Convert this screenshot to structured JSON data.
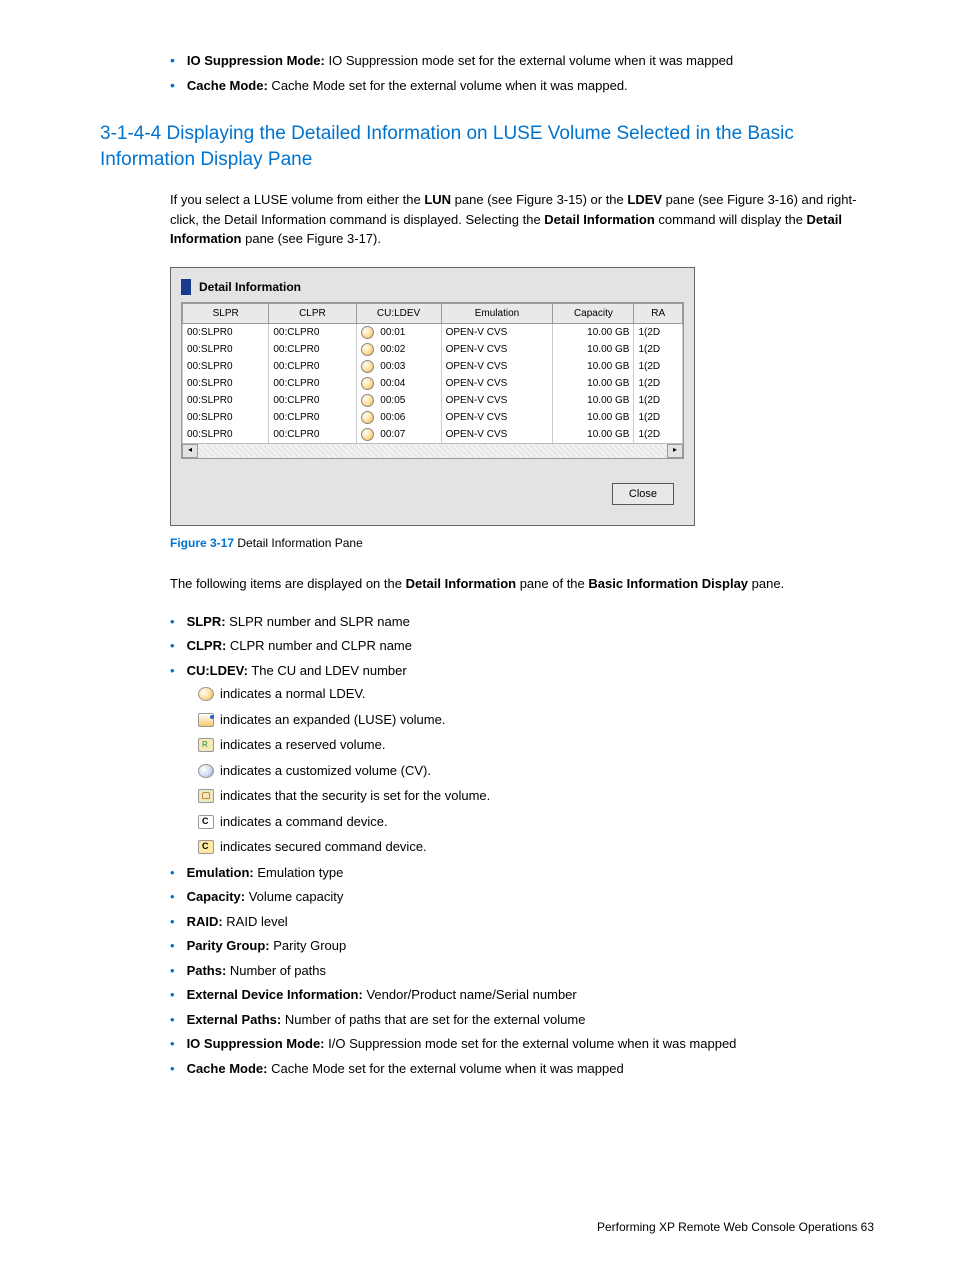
{
  "top_bullets": [
    {
      "label": "IO Suppression Mode:",
      "text": " IO Suppression mode set for the external volume when it was mapped"
    },
    {
      "label": "Cache Mode:",
      "text": " Cache Mode set for the external volume when it was mapped."
    }
  ],
  "heading": "3-1-4-4 Displaying the Detailed Information on LUSE Volume Selected in the Basic Information Display Pane",
  "intro": {
    "p1a": "If you select a LUSE volume from either the ",
    "lun": "LUN",
    "p1b": " pane (see Figure 3-15) or the ",
    "ldev": "LDEV",
    "p1c": " pane (see Figure 3-16) and right-click, the Detail Information command is displayed. Selecting the ",
    "di": "Detail Information",
    "p1d": " command will display the ",
    "di2": "Detail Information",
    "p1e": " pane (see Figure 3-17)."
  },
  "figure": {
    "title": "Detail Information",
    "headers": [
      "SLPR",
      "CLPR",
      "CU:LDEV",
      "Emulation",
      "Capacity",
      "RA"
    ],
    "rows": [
      {
        "slpr": "00:SLPR0",
        "clpr": "00:CLPR0",
        "ldev": "00:01",
        "emu": "OPEN-V CVS",
        "cap": "10.00 GB",
        "ra": "1(2D"
      },
      {
        "slpr": "00:SLPR0",
        "clpr": "00:CLPR0",
        "ldev": "00:02",
        "emu": "OPEN-V CVS",
        "cap": "10.00 GB",
        "ra": "1(2D"
      },
      {
        "slpr": "00:SLPR0",
        "clpr": "00:CLPR0",
        "ldev": "00:03",
        "emu": "OPEN-V CVS",
        "cap": "10.00 GB",
        "ra": "1(2D"
      },
      {
        "slpr": "00:SLPR0",
        "clpr": "00:CLPR0",
        "ldev": "00:04",
        "emu": "OPEN-V CVS",
        "cap": "10.00 GB",
        "ra": "1(2D"
      },
      {
        "slpr": "00:SLPR0",
        "clpr": "00:CLPR0",
        "ldev": "00:05",
        "emu": "OPEN-V CVS",
        "cap": "10.00 GB",
        "ra": "1(2D"
      },
      {
        "slpr": "00:SLPR0",
        "clpr": "00:CLPR0",
        "ldev": "00:06",
        "emu": "OPEN-V CVS",
        "cap": "10.00 GB",
        "ra": "1(2D"
      },
      {
        "slpr": "00:SLPR0",
        "clpr": "00:CLPR0",
        "ldev": "00:07",
        "emu": "OPEN-V CVS",
        "cap": "10.00 GB",
        "ra": "1(2D"
      }
    ],
    "close": "Close"
  },
  "figcap_label": "Figure 3-17",
  "figcap_text": "  Detail Information Pane",
  "after_fig": {
    "a": "The following items are displayed on the ",
    "b": "Detail Information",
    "c": " pane of the ",
    "d": "Basic Information Display",
    "e": " pane."
  },
  "items": [
    {
      "label": "SLPR:",
      "text": " SLPR number and SLPR name"
    },
    {
      "label": "CLPR:",
      "text": " CLPR number and CLPR name"
    },
    {
      "label": "CU:LDEV:",
      "text": " The CU and LDEV number",
      "sub": [
        {
          "ico": "normal",
          "text": "indicates a normal LDEV."
        },
        {
          "ico": "expanded",
          "text": "indicates an expanded (LUSE) volume."
        },
        {
          "ico": "reserved",
          "text": "indicates a reserved volume."
        },
        {
          "ico": "cv",
          "text": "indicates a customized volume (CV)."
        },
        {
          "ico": "sec",
          "text": "indicates that the security is set for the volume."
        },
        {
          "ico": "cmd",
          "text": "indicates a command device."
        },
        {
          "ico": "cmdsec",
          "text": "indicates secured command device."
        }
      ]
    },
    {
      "label": "Emulation:",
      "text": " Emulation type"
    },
    {
      "label": "Capacity:",
      "text": " Volume capacity"
    },
    {
      "label": "RAID:",
      "text": " RAID level"
    },
    {
      "label": "Parity Group:",
      "text": " Parity Group"
    },
    {
      "label": "Paths:",
      "text": " Number of paths"
    },
    {
      "label": "External Device Information:",
      "text": " Vendor/Product name/Serial number"
    },
    {
      "label": "External Paths:",
      "text": " Number of paths that are set for the external volume"
    },
    {
      "label": "IO Suppression Mode:",
      "text": " I/O Suppression mode set for the external volume when it was mapped"
    },
    {
      "label": "Cache Mode:",
      "text": " Cache Mode set for the external volume when it was mapped"
    }
  ],
  "footer": "Performing XP Remote Web Console Operations   63"
}
